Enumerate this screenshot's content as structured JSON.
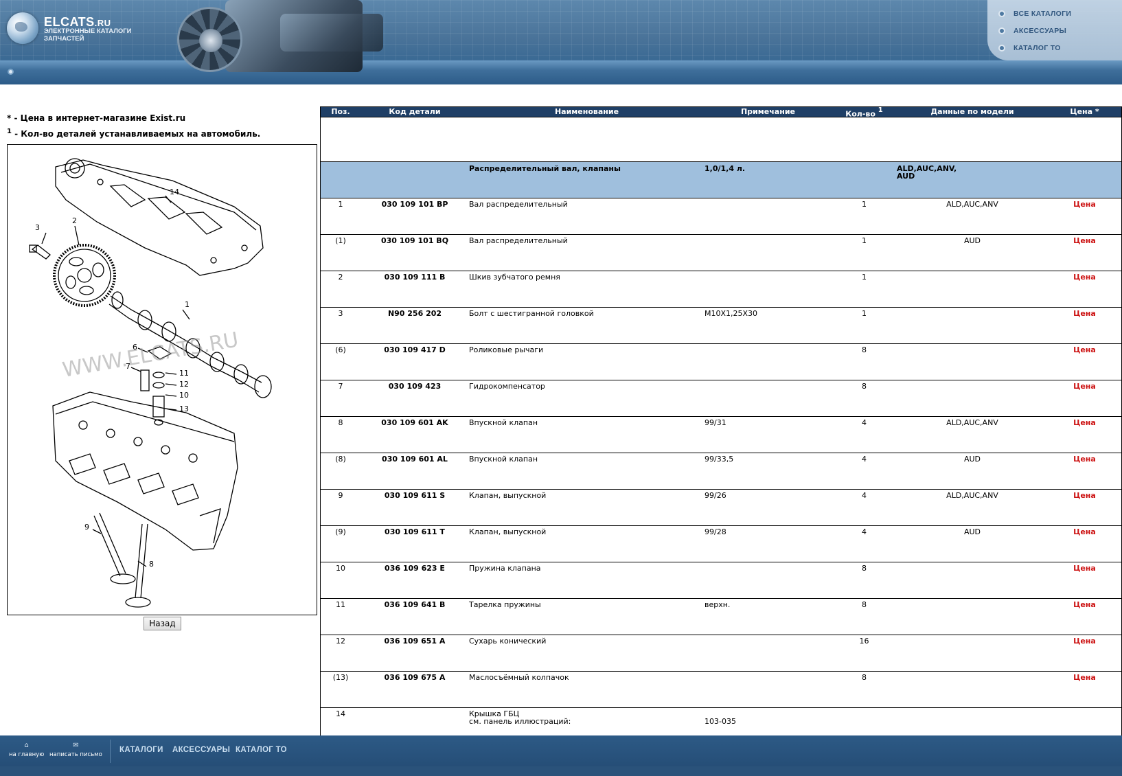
{
  "header": {
    "logo_main": "ELCATS",
    "logo_domain": ".RU",
    "logo_subtitle": "ЭЛЕКТРОННЫЕ КАТАЛОГИ ЗАПЧАСТЕЙ",
    "menu": [
      {
        "label": "ВСЕ КАТАЛОГИ"
      },
      {
        "label": "АКСЕССУАРЫ"
      },
      {
        "label": "КАТАЛОГ ТО"
      }
    ]
  },
  "notes": {
    "price_mark": "*",
    "price_note": " - Цена в интернет-магазине Exist.ru",
    "qty_mark": "1",
    "qty_note": " - Кол-во деталей устанавливаемых на автомобиль."
  },
  "diagram": {
    "watermark": "WWW.ELCATS.RU",
    "callouts": [
      "14",
      "3",
      "2",
      "1",
      "6",
      "7",
      "11",
      "12",
      "10",
      "13",
      "9",
      "8"
    ]
  },
  "back_button": "Назад",
  "table": {
    "headers": {
      "pos": "Поз.",
      "code": "Код детали",
      "name": "Наименование",
      "note": "Примечание",
      "qty": "Кол-во",
      "qty_sup": "1",
      "model": "Данные по модели",
      "price": "Цена *"
    },
    "group": {
      "name": "Распределительный вал, клапаны",
      "note": "1,0/1,4 л.",
      "model_line1": "ALD,AUC,ANV,",
      "model_line2": "AUD"
    },
    "rows": [
      {
        "pos": "1",
        "code": "030 109 101 BP",
        "name": "Вал распределительный",
        "note": "",
        "qty": "1",
        "model": "ALD,AUC,ANV",
        "price": "Цена"
      },
      {
        "pos": "(1)",
        "code": "030 109 101 BQ",
        "name": "Вал распределительный",
        "note": "",
        "qty": "1",
        "model": "AUD",
        "price": "Цена"
      },
      {
        "pos": "2",
        "code": "030 109 111 B",
        "name": "Шкив зубчатого ремня",
        "note": "",
        "qty": "1",
        "model": "",
        "price": "Цена"
      },
      {
        "pos": "3",
        "code": "N90 256 202",
        "name": "Болт с шестигранной головкой",
        "note": "M10X1,25X30",
        "qty": "1",
        "model": "",
        "price": "Цена"
      },
      {
        "pos": "(6)",
        "code": "030 109 417 D",
        "name": "Роликовые рычаги",
        "note": "",
        "qty": "8",
        "model": "",
        "price": "Цена"
      },
      {
        "pos": "7",
        "code": "030 109 423",
        "name": "Гидрокомпенсатор",
        "note": "",
        "qty": "8",
        "model": "",
        "price": "Цена"
      },
      {
        "pos": "8",
        "code": "030 109 601 AK",
        "name": "Впускной клапан",
        "note": "99/31",
        "qty": "4",
        "model": "ALD,AUC,ANV",
        "price": "Цена"
      },
      {
        "pos": "(8)",
        "code": "030 109 601 AL",
        "name": "Впускной клапан",
        "note": "99/33,5",
        "qty": "4",
        "model": "AUD",
        "price": "Цена"
      },
      {
        "pos": "9",
        "code": "030 109 611 S",
        "name": "Клапан, выпускной",
        "note": "99/26",
        "qty": "4",
        "model": "ALD,AUC,ANV",
        "price": "Цена"
      },
      {
        "pos": "(9)",
        "code": "030 109 611 T",
        "name": "Клапан, выпускной",
        "note": "99/28",
        "qty": "4",
        "model": "AUD",
        "price": "Цена"
      },
      {
        "pos": "10",
        "code": "036 109 623 E",
        "name": "Пружина клапана",
        "note": "",
        "qty": "8",
        "model": "",
        "price": "Цена"
      },
      {
        "pos": "11",
        "code": "036 109 641 B",
        "name": "Тарелка пружины",
        "note": "верхн.",
        "qty": "8",
        "model": "",
        "price": "Цена"
      },
      {
        "pos": "12",
        "code": "036 109 651 A",
        "name": "Сухарь конический",
        "note": "",
        "qty": "16",
        "model": "",
        "price": "Цена"
      },
      {
        "pos": "(13)",
        "code": "036 109 675 A",
        "name": "Маслосъёмный колпачок",
        "note": "",
        "qty": "8",
        "model": "",
        "price": "Цена"
      },
      {
        "pos": "14",
        "code": "",
        "name": "Крышка ГБЦ",
        "name2": "см. панель иллюстраций:",
        "note": "",
        "note2": "103-035",
        "qty": "",
        "model": "",
        "price": ""
      }
    ]
  },
  "footer": {
    "home_label": "на главную",
    "mail_label": "написать письмо",
    "links": [
      "КАТАЛОГИ",
      "АКСЕССУАРЫ",
      "КАТАЛОГ ТО"
    ]
  }
}
